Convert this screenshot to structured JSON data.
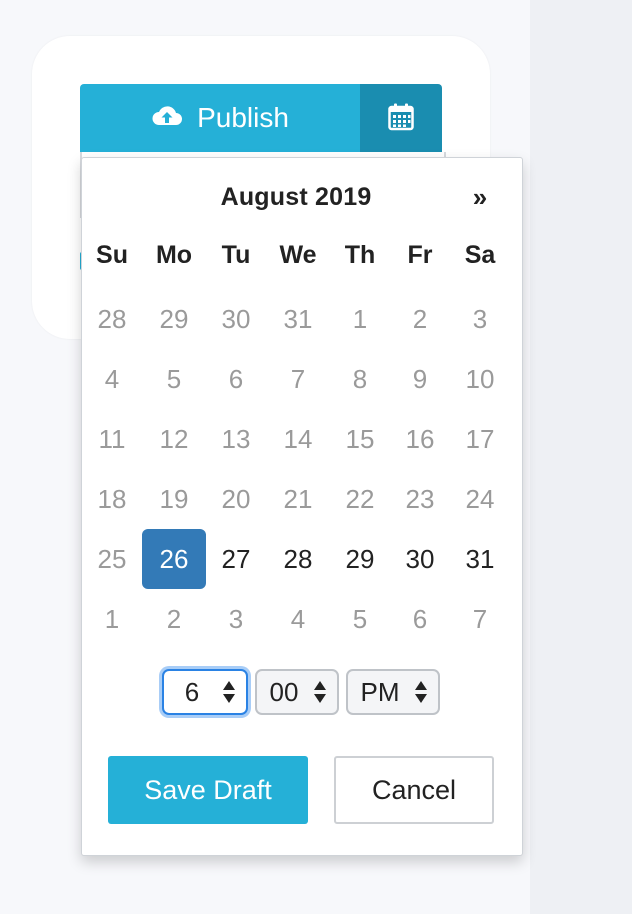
{
  "publish": {
    "label": "Publish",
    "icon": "cloud-upload-icon",
    "calendar_icon": "calendar-icon"
  },
  "calendar": {
    "month_label": "August 2019",
    "next_label": "»",
    "weekdays": [
      "Su",
      "Mo",
      "Tu",
      "We",
      "Th",
      "Fr",
      "Sa"
    ],
    "weeks": [
      [
        "28",
        "29",
        "30",
        "31",
        "1",
        "2",
        "3"
      ],
      [
        "4",
        "5",
        "6",
        "7",
        "8",
        "9",
        "10"
      ],
      [
        "11",
        "12",
        "13",
        "14",
        "15",
        "16",
        "17"
      ],
      [
        "18",
        "19",
        "20",
        "21",
        "22",
        "23",
        "24"
      ],
      [
        "25",
        "26",
        "27",
        "28",
        "29",
        "30",
        "31"
      ],
      [
        "1",
        "2",
        "3",
        "4",
        "5",
        "6",
        "7"
      ]
    ],
    "selected_day": "26"
  },
  "time": {
    "hour": "6",
    "minute": "00",
    "ampm": "PM"
  },
  "actions": {
    "save_label": "Save Draft",
    "cancel_label": "Cancel"
  },
  "colors": {
    "accent": "#25b0d7",
    "accent_dark": "#1a8db0",
    "selected": "#337ab7",
    "muted_text": "#9a9a9a"
  }
}
